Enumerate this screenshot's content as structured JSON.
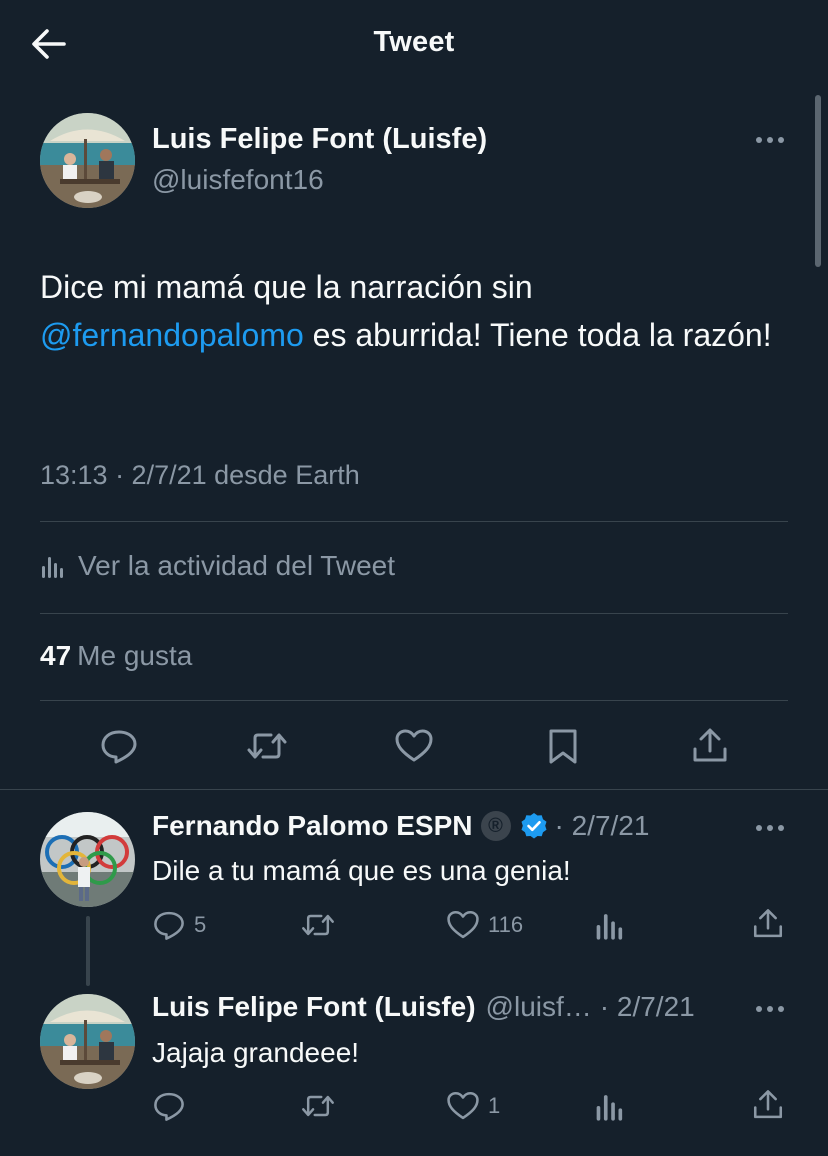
{
  "header": {
    "title": "Tweet",
    "back_icon": "arrow-left-icon"
  },
  "tweet": {
    "author_name": "Luis Felipe Font (Luisfe)",
    "author_handle": "@luisfefont16",
    "text_before": "Dice mi mamá que la narración sin ",
    "mention": "@fernandopalomo",
    "text_after": " es aburrida! Tiene toda la razón!",
    "timestamp": "13:13 · 2/7/21 desde Earth",
    "activity_label": "Ver la actividad del Tweet",
    "likes_count": "47",
    "likes_label": "Me gusta",
    "actions": [
      "reply-icon",
      "retweet-icon",
      "like-icon",
      "bookmark-icon",
      "share-icon"
    ]
  },
  "replies": [
    {
      "name": "Fernando Palomo ESPN",
      "registered_mark": "®",
      "verified": true,
      "date": "· 2/7/21",
      "text": "Dile a tu mamá que es una genia!",
      "reply_count": "5",
      "retweet_count": "",
      "like_count": "116"
    },
    {
      "name": "Luis Felipe Font (Luisfe)",
      "handle": "@luisf…",
      "date": "· 2/7/21",
      "text": "Jajaja grandeee!",
      "reply_count": "",
      "retweet_count": "",
      "like_count": "1"
    }
  ],
  "colors": {
    "background": "#15202b",
    "accent": "#1d9bf0",
    "muted": "#8b98a5",
    "divider": "#38444d"
  }
}
